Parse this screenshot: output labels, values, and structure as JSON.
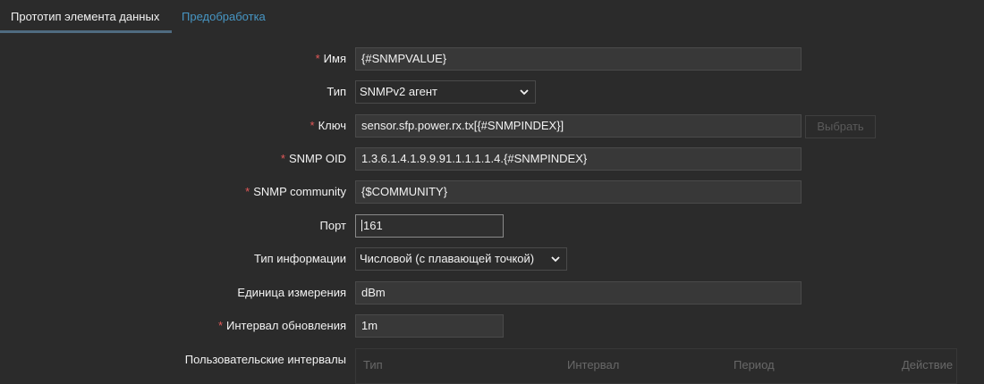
{
  "tabs": {
    "active": "Прототип элемента данных",
    "inactive": "Предобработка"
  },
  "fields": {
    "name": {
      "label": "Имя",
      "value": "{#SNMPVALUE}"
    },
    "type": {
      "label": "Тип",
      "value": "SNMPv2 агент"
    },
    "key": {
      "label": "Ключ",
      "value": "sensor.sfp.power.rx.tx[{#SNMPINDEX}]",
      "button": "Выбрать"
    },
    "snmp_oid": {
      "label": "SNMP OID",
      "value": "1.3.6.1.4.1.9.9.91.1.1.1.1.4.{#SNMPINDEX}"
    },
    "snmp_community": {
      "label": "SNMP community",
      "value": "{$COMMUNITY}"
    },
    "port": {
      "label": "Порт",
      "value": "161"
    },
    "info_type": {
      "label": "Тип информации",
      "value": "Числовой (с плавающей точкой)"
    },
    "units": {
      "label": "Единица измерения",
      "value": "dBm"
    },
    "interval": {
      "label": "Интервал обновления",
      "value": "1m"
    },
    "custom_intervals": {
      "label": "Пользовательские интервалы",
      "columns": [
        "Тип",
        "Интервал",
        "Период",
        "Действие"
      ]
    }
  },
  "required_marker": "*",
  "colors": {
    "background": "#2b2b2b",
    "input_bg": "#383838",
    "link": "#4796c4",
    "required": "#e45959",
    "tab_underline": "#4f6b80"
  }
}
